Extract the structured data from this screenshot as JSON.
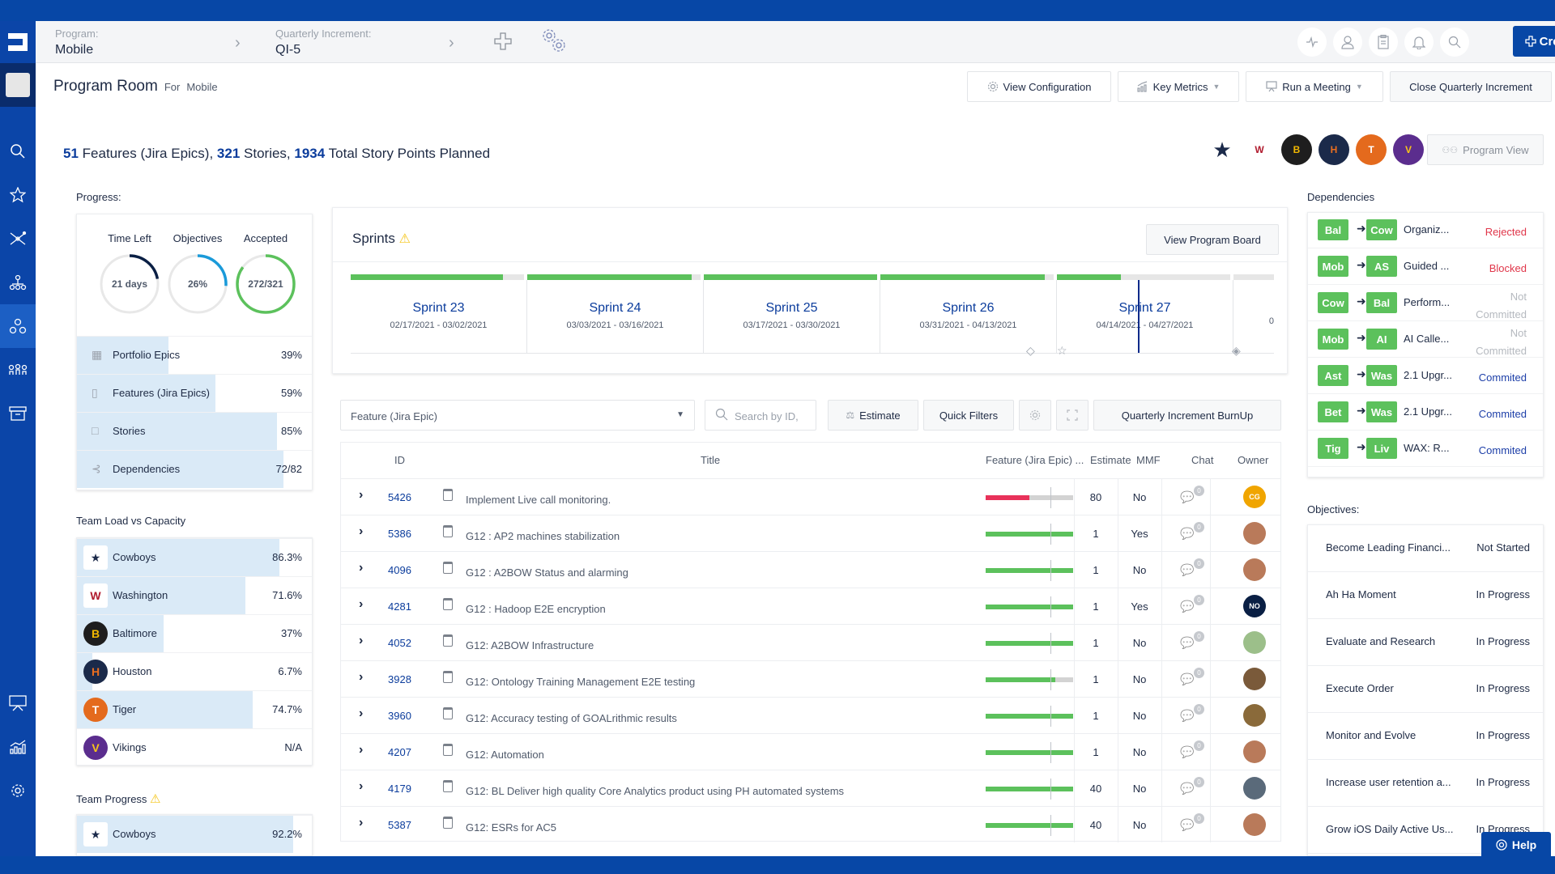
{
  "header": {
    "program_label": "Program:",
    "program_value": "Mobile",
    "qi_label": "Quarterly Increment:",
    "qi_value": "QI-5",
    "create_label": "Create",
    "icons": [
      "add-icon",
      "settings-gears-icon",
      "activity-icon",
      "user-icon",
      "clipboard-icon",
      "bell-icon",
      "search-icon"
    ]
  },
  "sidebar": {
    "items": [
      "search",
      "favorites",
      "network",
      "hierarchy",
      "program-room",
      "teams",
      "archive",
      "presentation",
      "metrics",
      "settings"
    ],
    "active": "program-room"
  },
  "page": {
    "title": "Program Room",
    "for_label": "For",
    "for_value": "Mobile"
  },
  "toolbar": {
    "view_configuration": "View Configuration",
    "key_metrics": "Key Metrics",
    "run_meeting": "Run a Meeting",
    "close_qi": "Close Quarterly Increment",
    "program_view": "Program View"
  },
  "summary": {
    "features_count": "51",
    "features_label": " Features (Jira Epics), ",
    "stories_count": "321",
    "stories_label": " Stories, ",
    "points_count": "1934",
    "points_label": " Total Story Points Planned"
  },
  "team_logos": [
    {
      "name": "Cowboys",
      "color": "#ffffff",
      "fg": "#1b2a4a",
      "glyph": "★"
    },
    {
      "name": "Washington",
      "color": "#ffffff",
      "fg": "#b01b2e",
      "glyph": "W"
    },
    {
      "name": "Baltimore",
      "color": "#1e1e1e",
      "fg": "#f2b800",
      "glyph": "B"
    },
    {
      "name": "Houston",
      "color": "#1b2a4a",
      "fg": "#eb6e1f",
      "glyph": "H"
    },
    {
      "name": "Tiger",
      "color": "#e46a1d",
      "fg": "#ffffff",
      "glyph": "T"
    },
    {
      "name": "Vikings",
      "color": "#5b2d8e",
      "fg": "#f6c41a",
      "glyph": "V"
    }
  ],
  "progress": {
    "label": "Progress:",
    "rings": [
      {
        "title": "Time Left",
        "value": "21 days",
        "fraction": 0.22,
        "color": "#0a1f44"
      },
      {
        "title": "Objectives",
        "value": "26%",
        "fraction": 0.26,
        "color": "#1a9ad9"
      },
      {
        "title": "Accepted",
        "value": "272/321",
        "fraction": 0.85,
        "color": "#5cc15c"
      }
    ],
    "bars": [
      {
        "label": "Portfolio Epics",
        "icon": "grid-icon",
        "glyph": "▦",
        "value": "39%",
        "fraction": 0.39
      },
      {
        "label": "Features (Jira Epics)",
        "icon": "feature-icon",
        "glyph": "▯",
        "value": "59%",
        "fraction": 0.59
      },
      {
        "label": "Stories",
        "icon": "story-icon",
        "glyph": "□",
        "value": "85%",
        "fraction": 0.85
      },
      {
        "label": "Dependencies",
        "icon": "dependency-icon",
        "glyph": "⊰",
        "value": "72/82",
        "fraction": 0.878
      }
    ]
  },
  "team_load": {
    "label": "Team Load vs Capacity",
    "teams": [
      {
        "name": "Cowboys",
        "value": "86.3%",
        "fraction": 0.863,
        "glyph": "★",
        "fg": "#1b2a4a",
        "bg": "#ffffff"
      },
      {
        "name": "Washington",
        "value": "71.6%",
        "fraction": 0.716,
        "glyph": "W",
        "fg": "#b01b2e",
        "bg": "#ffffff"
      },
      {
        "name": "Baltimore",
        "value": "37%",
        "fraction": 0.37,
        "glyph": "B",
        "fg": "#f2b800",
        "bg": "#1e1e1e"
      },
      {
        "name": "Houston",
        "value": "6.7%",
        "fraction": 0.067,
        "glyph": "H",
        "fg": "#eb6e1f",
        "bg": "#1b2a4a"
      },
      {
        "name": "Tiger",
        "value": "74.7%",
        "fraction": 0.747,
        "glyph": "T",
        "fg": "#ffffff",
        "bg": "#e46a1d"
      },
      {
        "name": "Vikings",
        "value": "N/A",
        "fraction": 0,
        "glyph": "V",
        "fg": "#f6c41a",
        "bg": "#5b2d8e"
      }
    ]
  },
  "team_progress": {
    "label": "Team Progress",
    "teams": [
      {
        "name": "Cowboys",
        "value": "92.2%",
        "fraction": 0.922,
        "glyph": "★",
        "fg": "#1b2a4a",
        "bg": "#ffffff"
      }
    ]
  },
  "sprints": {
    "title": "Sprints",
    "view_board": "View Program Board",
    "items": [
      {
        "name": "Sprint 23",
        "dates": "02/17/2021 - 03/02/2021",
        "fraction": 0.88
      },
      {
        "name": "Sprint 24",
        "dates": "03/03/2021 - 03/16/2021",
        "fraction": 0.95
      },
      {
        "name": "Sprint 25",
        "dates": "03/17/2021 - 03/30/2021",
        "fraction": 1.0
      },
      {
        "name": "Sprint 26",
        "dates": "03/31/2021 - 04/13/2021",
        "fraction": 0.95
      },
      {
        "name": "Sprint 27",
        "dates": "04/14/2021 - 04/27/2021",
        "fraction": 0.37
      }
    ],
    "overflow_label": "0"
  },
  "filters": {
    "type_select": "Feature (Jira Epic)",
    "search_placeholder": "Search by ID,",
    "estimate": "Estimate",
    "quick_filters": "Quick Filters",
    "burnup": "Quarterly Increment BurnUp"
  },
  "table": {
    "headers": {
      "id": "ID",
      "title": "Title",
      "progress": "Feature (Jira Epic) ...",
      "estimate": "Estimate",
      "mmf": "MMF",
      "chat": "Chat",
      "owner": "Owner"
    },
    "rows": [
      {
        "id": "5426",
        "title": "Implement Live call monitoring.",
        "progress": 0.5,
        "progress_color": "#e8325a",
        "estimate": "80",
        "mmf": "No",
        "chat": "0",
        "owner": "CG",
        "owner_color": "#f0a500"
      },
      {
        "id": "5386",
        "title": "G12 : AP2 machines stabilization",
        "progress": 1.0,
        "progress_color": "#5cc15c",
        "estimate": "1",
        "mmf": "Yes",
        "chat": "0",
        "owner": "",
        "owner_color": "#b97a5a"
      },
      {
        "id": "4096",
        "title": "G12 : A2BOW Status and alarming",
        "progress": 1.0,
        "progress_color": "#5cc15c",
        "estimate": "1",
        "mmf": "No",
        "chat": "0",
        "owner": "",
        "owner_color": "#b97a5a"
      },
      {
        "id": "4281",
        "title": "G12 : Hadoop E2E encryption",
        "progress": 1.0,
        "progress_color": "#5cc15c",
        "estimate": "1",
        "mmf": "Yes",
        "chat": "0",
        "owner": "NO",
        "owner_color": "#0a1f44"
      },
      {
        "id": "4052",
        "title": "G12: A2BOW Infrastructure",
        "progress": 1.0,
        "progress_color": "#5cc15c",
        "estimate": "1",
        "mmf": "No",
        "chat": "0",
        "owner": "",
        "owner_color": "#9cbf8a"
      },
      {
        "id": "3928",
        "title": "G12: Ontology Training Management E2E testing",
        "progress": 0.8,
        "progress_color": "#5cc15c",
        "estimate": "1",
        "mmf": "No",
        "chat": "0",
        "owner": "",
        "owner_color": "#7a5a3a"
      },
      {
        "id": "3960",
        "title": "G12: Accuracy testing of GOALrithmic results",
        "progress": 1.0,
        "progress_color": "#5cc15c",
        "estimate": "1",
        "mmf": "No",
        "chat": "0",
        "owner": "",
        "owner_color": "#8a6a3a"
      },
      {
        "id": "4207",
        "title": "G12: Automation",
        "progress": 1.0,
        "progress_color": "#5cc15c",
        "estimate": "1",
        "mmf": "No",
        "chat": "0",
        "owner": "",
        "owner_color": "#b97a5a"
      },
      {
        "id": "4179",
        "title": "G12: BL Deliver high quality Core Analytics product using PH automated systems",
        "progress": 1.0,
        "progress_color": "#5cc15c",
        "estimate": "40",
        "mmf": "No",
        "chat": "0",
        "owner": "",
        "owner_color": "#5a6a7a"
      },
      {
        "id": "5387",
        "title": "G12: ESRs for AC5",
        "progress": 1.0,
        "progress_color": "#5cc15c",
        "estimate": "40",
        "mmf": "No",
        "chat": "0",
        "owner": "",
        "owner_color": "#b97a5a"
      }
    ]
  },
  "dependencies": {
    "label": "Dependencies",
    "items": [
      {
        "from": "Bal",
        "to": "Cow",
        "name": "Organiz...",
        "status": "Rejected",
        "status_color": "#e0364a"
      },
      {
        "from": "Mob",
        "to": "AS",
        "name": "Guided ...",
        "status": "Blocked",
        "status_color": "#e0364a"
      },
      {
        "from": "Cow",
        "to": "Bal",
        "name": "Perform...",
        "status": "Not Committed",
        "status_color": "#b5b9bf"
      },
      {
        "from": "Mob",
        "to": "AI",
        "name": "AI Calle...",
        "status": "Not Committed",
        "status_color": "#b5b9bf"
      },
      {
        "from": "Ast",
        "to": "Was",
        "name": "2.1 Upgr...",
        "status": "Commited",
        "status_color": "#1d3fa8"
      },
      {
        "from": "Bet",
        "to": "Was",
        "name": "2.1 Upgr...",
        "status": "Commited",
        "status_color": "#1d3fa8"
      },
      {
        "from": "Tig",
        "to": "Liv",
        "name": "WAX: R...",
        "status": "Commited",
        "status_color": "#1d3fa8"
      }
    ]
  },
  "objectives": {
    "label": "Objectives:",
    "items": [
      {
        "name": "Become Leading Financi...",
        "status": "Not Started"
      },
      {
        "name": "Ah Ha Moment",
        "status": "In Progress"
      },
      {
        "name": "Evaluate and Research",
        "status": "In Progress"
      },
      {
        "name": "Execute Order",
        "status": "In Progress"
      },
      {
        "name": "Monitor and Evolve",
        "status": "In Progress"
      },
      {
        "name": "Increase user retention a...",
        "status": "In Progress"
      },
      {
        "name": "Grow iOS Daily Active Us...",
        "status": "In Progress"
      }
    ]
  },
  "help_label": "Help"
}
